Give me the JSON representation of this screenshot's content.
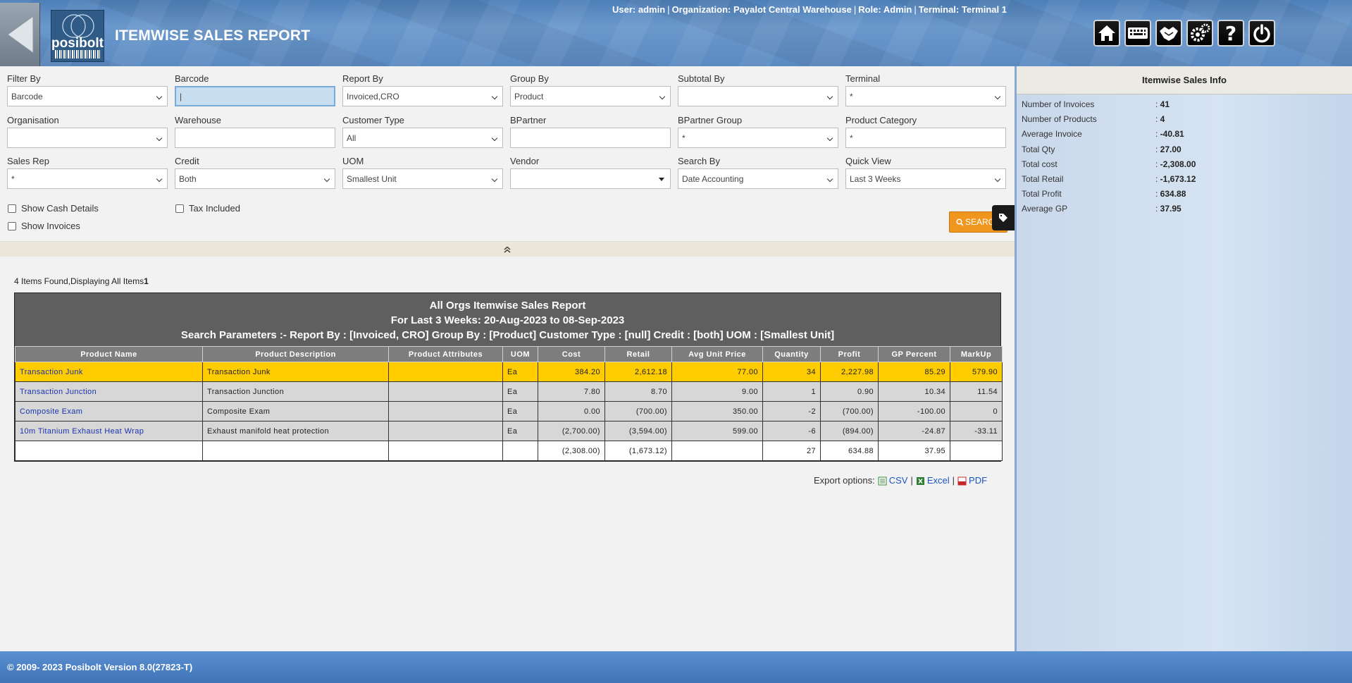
{
  "header": {
    "title": "ITEMWISE SALES REPORT",
    "logo_text": "posibolt",
    "user_label": "User:",
    "user": "admin",
    "org_label": "Organization:",
    "org": "Payalot Central Warehouse",
    "role_label": "Role:",
    "role": "Admin",
    "terminal_label": "Terminal:",
    "terminal": "Terminal 1"
  },
  "filters": {
    "filter_by": {
      "label": "Filter By",
      "value": "Barcode"
    },
    "barcode": {
      "label": "Barcode",
      "value": "|"
    },
    "report_by": {
      "label": "Report By",
      "value": "Invoiced,CRO"
    },
    "group_by": {
      "label": "Group By",
      "value": "Product"
    },
    "subtotal_by": {
      "label": "Subtotal By",
      "value": ""
    },
    "terminal": {
      "label": "Terminal",
      "value": "*"
    },
    "organisation": {
      "label": "Organisation",
      "value": ""
    },
    "warehouse": {
      "label": "Warehouse",
      "value": ""
    },
    "customer_type": {
      "label": "Customer Type",
      "value": "All"
    },
    "bpartner": {
      "label": "BPartner",
      "value": ""
    },
    "bpartner_group": {
      "label": "BPartner Group",
      "value": "*"
    },
    "product_category": {
      "label": "Product Category",
      "value": "*"
    },
    "sales_rep": {
      "label": "Sales Rep",
      "value": "*"
    },
    "credit": {
      "label": "Credit",
      "value": "Both"
    },
    "uom": {
      "label": "UOM",
      "value": "Smallest Unit"
    },
    "vendor": {
      "label": "Vendor",
      "value": ""
    },
    "search_by": {
      "label": "Search By",
      "value": "Date Accounting"
    },
    "quick_view": {
      "label": "Quick View",
      "value": "Last 3 Weeks"
    },
    "show_cash_details": "Show Cash Details",
    "tax_included": "Tax Included",
    "show_invoices": "Show Invoices",
    "search_label": "SEARCH"
  },
  "results": {
    "found_text": "4 Items Found,Displaying All Items",
    "page": "1",
    "report_title": "All Orgs Itemwise Sales Report",
    "report_period": "For Last 3 Weeks: 20-Aug-2023 to 08-Sep-2023",
    "report_params": "Search Parameters :- Report By : [Invoiced, CRO] Group By : [Product] Customer Type : [null] Credit : [both] UOM : [Smallest Unit]",
    "columns": [
      "Product Name",
      "Product Description",
      "Product Attributes",
      "UOM",
      "Cost",
      "Retail",
      "Avg Unit Price",
      "Quantity",
      "Profit",
      "GP Percent",
      "MarkUp"
    ],
    "rows": [
      {
        "name": "Transaction Junk",
        "desc": "Transaction Junk",
        "attr": "",
        "uom": "Ea",
        "cost": "384.20",
        "retail": "2,612.18",
        "avg": "77.00",
        "qty": "34",
        "profit": "2,227.98",
        "gp": "85.29",
        "markup": "579.90"
      },
      {
        "name": "Transaction Junction",
        "desc": "Transaction Junction",
        "attr": "",
        "uom": "Ea",
        "cost": "7.80",
        "retail": "8.70",
        "avg": "9.00",
        "qty": "1",
        "profit": "0.90",
        "gp": "10.34",
        "markup": "11.54"
      },
      {
        "name": "Composite Exam",
        "desc": "Composite Exam",
        "attr": "",
        "uom": "Ea",
        "cost": "0.00",
        "retail": "(700.00)",
        "avg": "350.00",
        "qty": "-2",
        "profit": "(700.00)",
        "gp": "-100.00",
        "markup": "0"
      },
      {
        "name": "10m Titanium Exhaust Heat Wrap",
        "desc": "Exhaust manifold heat protection",
        "attr": "",
        "uom": "Ea",
        "cost": "(2,700.00)",
        "retail": "(3,594.00)",
        "avg": "599.00",
        "qty": "-6",
        "profit": "(894.00)",
        "gp": "-24.87",
        "markup": "-33.11"
      }
    ],
    "totals": {
      "cost": "(2,308.00)",
      "retail": "(1,673.12)",
      "qty": "27",
      "profit": "634.88",
      "gp": "37.95"
    },
    "export_label": "Export options:",
    "export_csv": "CSV",
    "export_excel": "Excel",
    "export_pdf": "PDF"
  },
  "info": {
    "title": "Itemwise Sales Info",
    "items": [
      {
        "label": "Number of Invoices",
        "value": "41"
      },
      {
        "label": "Number of Products",
        "value": "4"
      },
      {
        "label": "Average Invoice",
        "value": "-40.81"
      },
      {
        "label": "Total Qty",
        "value": "27.00"
      },
      {
        "label": "Total cost",
        "value": "-2,308.00"
      },
      {
        "label": "Total Retail",
        "value": "-1,673.12"
      },
      {
        "label": "Total Profit",
        "value": "634.88"
      },
      {
        "label": "Average GP",
        "value": "37.95"
      }
    ]
  },
  "footer": {
    "text": "© 2009- 2023 Posibolt Version  8.0(27823-T)"
  },
  "colors": {
    "accent": "#f0961e",
    "highlight": "#ffcc00",
    "link": "#1a33b0"
  }
}
